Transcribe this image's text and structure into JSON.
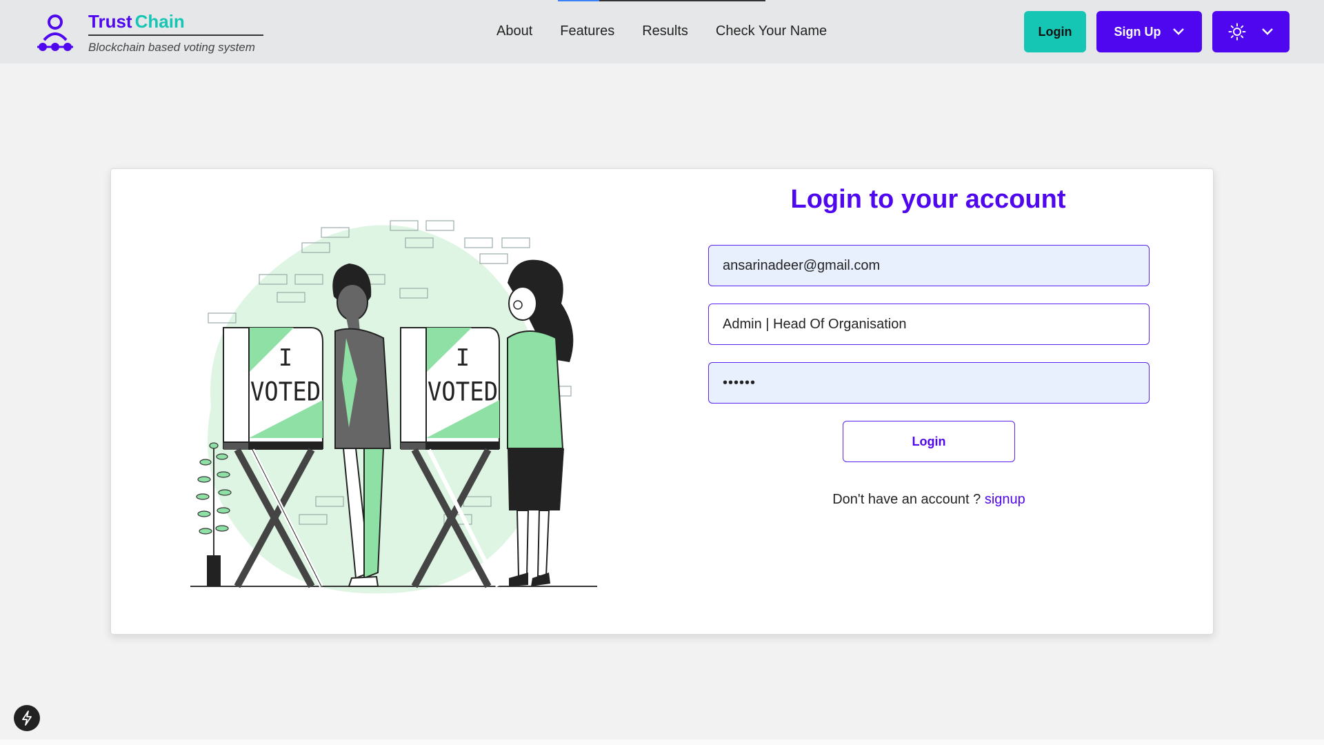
{
  "brand": {
    "name_part1": "Trust",
    "name_part2": "Chain",
    "tagline": "Blockchain based voting system"
  },
  "nav": {
    "items": [
      "About",
      "Features",
      "Results",
      "Check Your Name"
    ]
  },
  "header_buttons": {
    "login": "Login",
    "signup": "Sign Up",
    "theme_icon": "sun-icon"
  },
  "illustration": {
    "sign_line1": "I",
    "sign_line2": "VOTED"
  },
  "form": {
    "title": "Login to your account",
    "email_value": "ansarinadeer@gmail.com",
    "role_value": "Admin | Head Of Organisation",
    "password_value": "••••••",
    "submit_label": "Login",
    "signup_prompt": "Don't have an account ?",
    "signup_link": "signup"
  },
  "colors": {
    "primary": "#4f07ef",
    "accent": "#16c6b4",
    "illustration_green": "#8fe0a5"
  }
}
